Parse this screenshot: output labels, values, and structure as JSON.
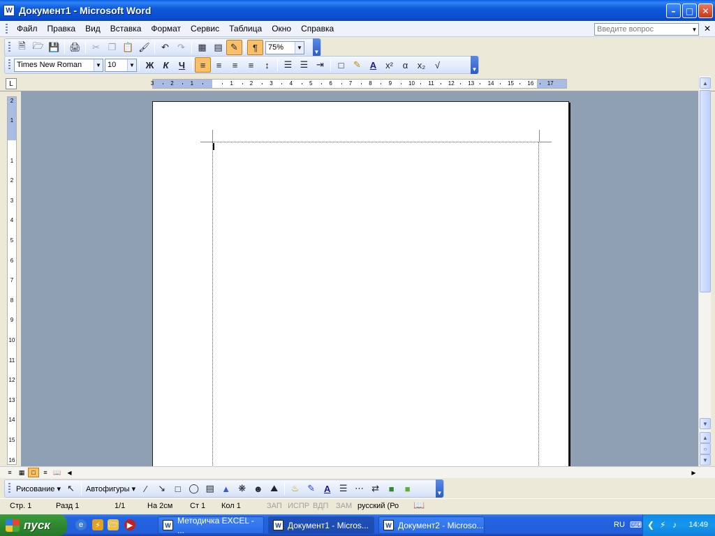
{
  "window": {
    "title": "Документ1 - Microsoft Word",
    "icon": "W"
  },
  "menu": {
    "items": [
      "Файл",
      "Правка",
      "Вид",
      "Вставка",
      "Формат",
      "Сервис",
      "Таблица",
      "Окно",
      "Справка"
    ],
    "ask_placeholder": "Введите вопрос"
  },
  "toolbar_standard": {
    "zoom": "75%"
  },
  "toolbar_formatting": {
    "font_name": "Times New Roman",
    "font_size": "10"
  },
  "ruler": {
    "h_labels": [
      "3",
      "2",
      "1",
      "1",
      "2",
      "3",
      "4",
      "5",
      "6",
      "7",
      "8",
      "9",
      "10",
      "11",
      "12",
      "13",
      "14",
      "15",
      "16",
      "17"
    ],
    "v_labels": [
      "2",
      "1",
      "1",
      "2",
      "3",
      "4",
      "5",
      "6",
      "7",
      "8",
      "9",
      "10",
      "11",
      "12",
      "13",
      "14",
      "15",
      "16"
    ]
  },
  "drawing": {
    "draw_label": "Рисование",
    "autoshapes_label": "Автофигуры"
  },
  "status": {
    "page": "Стр. 1",
    "section": "Разд 1",
    "pages": "1/1",
    "at": "На 2см",
    "line": "Ст 1",
    "col": "Кол 1",
    "rec": "ЗАП",
    "trk": "ИСПР",
    "ext": "ВДП",
    "ovr": "ЗАМ",
    "language": "русский (Ро"
  },
  "taskbar": {
    "start_label": "пуск",
    "tasks": [
      {
        "label": "Методичка EXCEL - ..."
      },
      {
        "label": "Документ1 - Micros..."
      },
      {
        "label": "Документ2 - Microso..."
      }
    ],
    "language": "RU",
    "clock": "14:49"
  }
}
